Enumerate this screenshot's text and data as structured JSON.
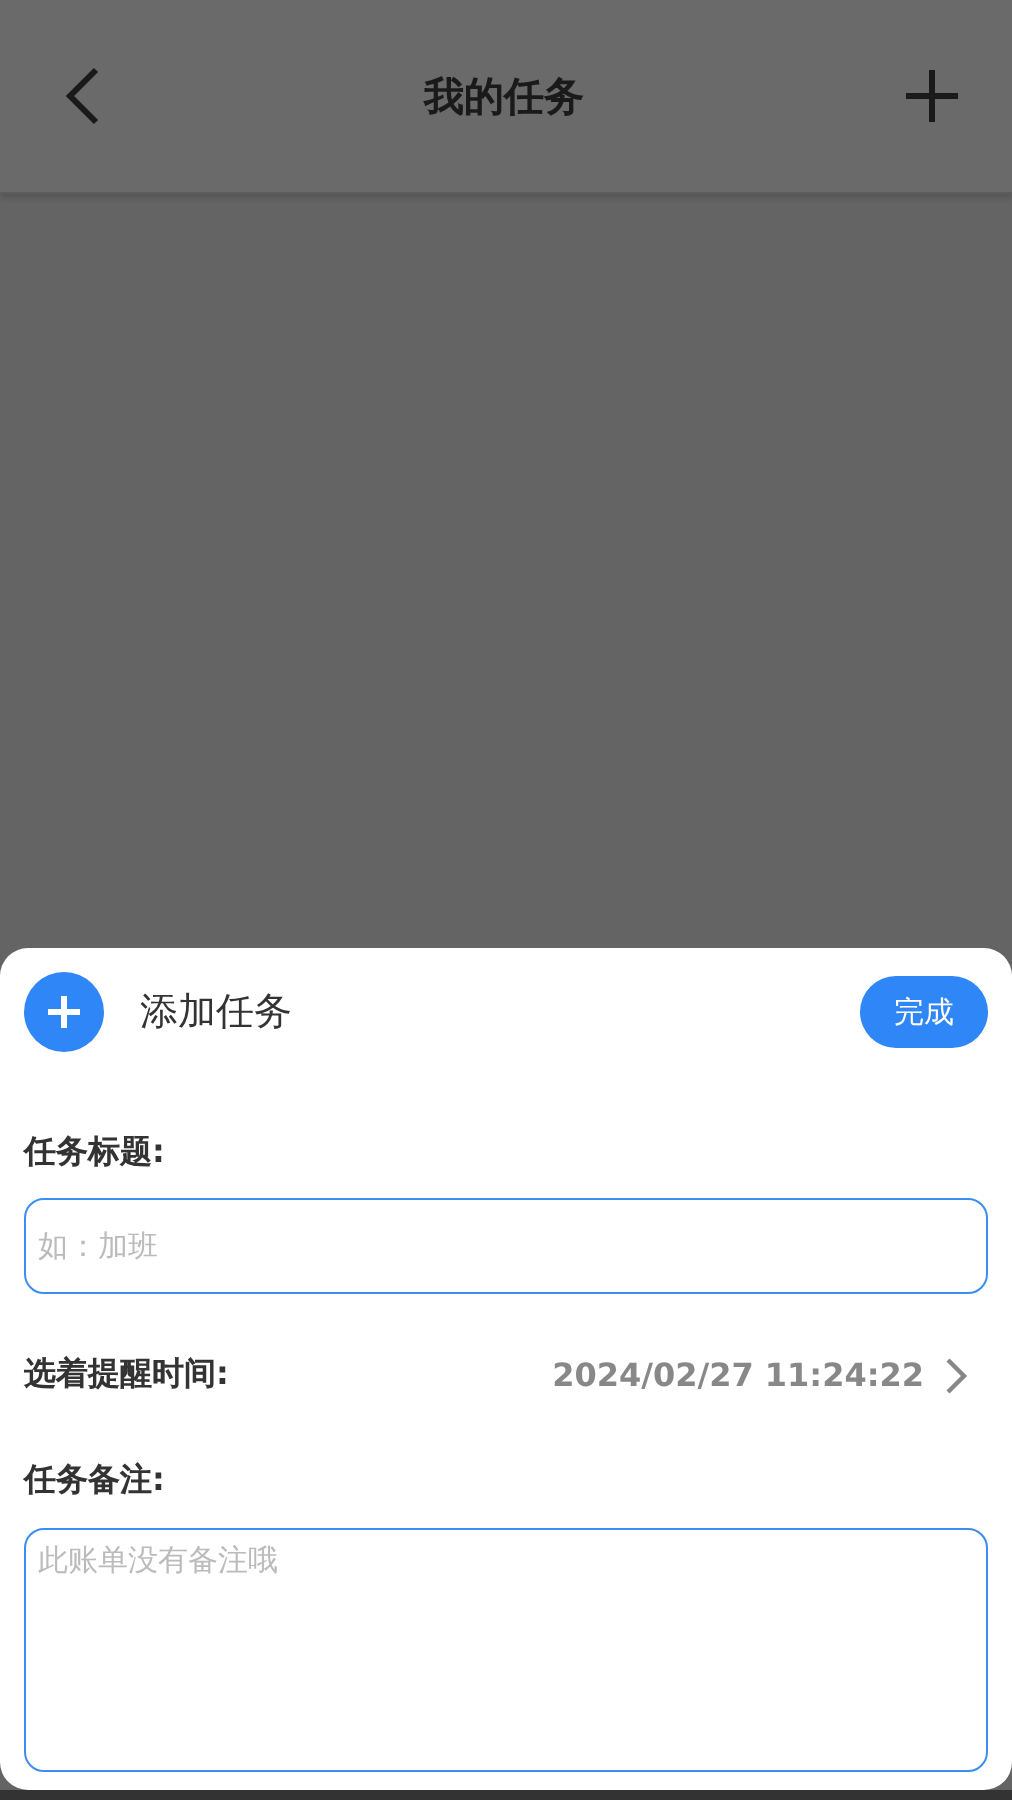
{
  "header": {
    "title": "我的任务"
  },
  "sheet": {
    "title": "添加任务",
    "done_button": "完成",
    "fields": [
      {
        "kind": "input",
        "label": "任务标题:",
        "placeholder": "如：加班"
      },
      {
        "kind": "picker",
        "label": "选着提醒时间:",
        "value": "2024/02/27 11:24:22"
      },
      {
        "kind": "textarea",
        "label": "任务备注:",
        "placeholder": "此账单没有备注哦"
      }
    ]
  }
}
